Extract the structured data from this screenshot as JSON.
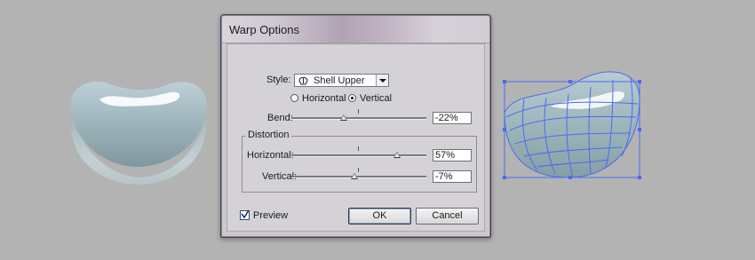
{
  "dialog": {
    "title": "Warp Options",
    "style": {
      "label": "Style:",
      "value": "Shell Upper",
      "icon": "shell-upper-icon"
    },
    "orientation": {
      "horizontal_label": "Horizontal",
      "vertical_label": "Vertical",
      "selected": "Vertical"
    },
    "bend": {
      "label": "Bend:",
      "value": "-22%",
      "level_percent": -22
    },
    "distortion": {
      "legend": "Distortion",
      "horizontal": {
        "label": "Horizontal:",
        "value": "57%",
        "level_percent": 57
      },
      "vertical": {
        "label": "Vertical:",
        "value": "-7%",
        "level_percent": -7
      }
    },
    "preview": {
      "label": "Preview",
      "checked": true
    },
    "ok_label": "OK",
    "cancel_label": "Cancel"
  },
  "colors": {
    "background": "#b3b3b3",
    "selection_blue": "#4a6cf0",
    "object_fill": "#9fb3bb"
  }
}
